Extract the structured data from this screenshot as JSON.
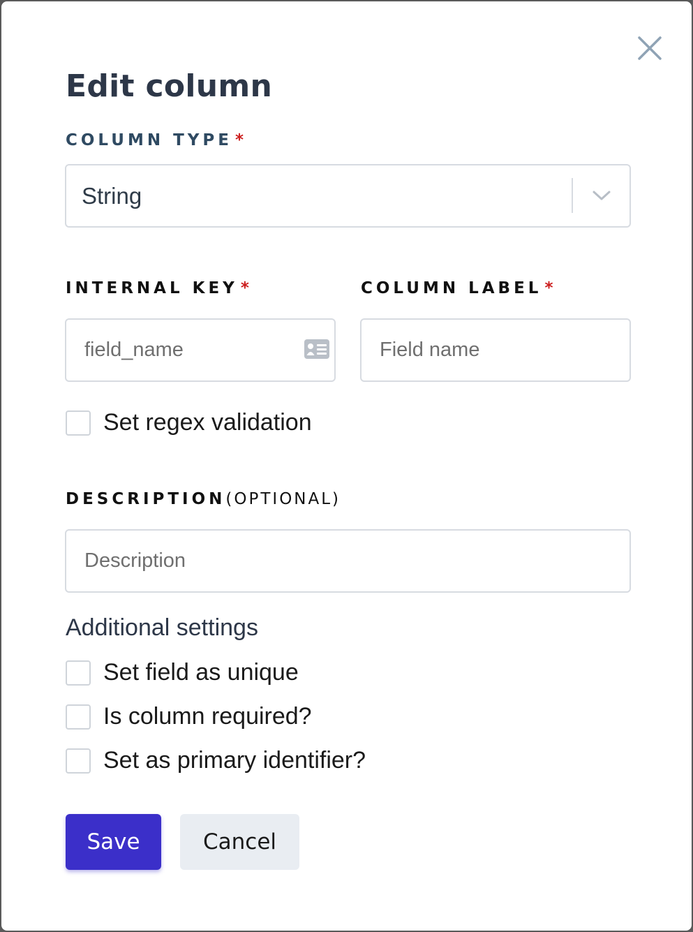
{
  "dialog": {
    "title": "Edit column",
    "close_icon": "close-icon"
  },
  "column_type": {
    "label": "COLUMN TYPE",
    "required_mark": "*",
    "selected_value": "String",
    "chevron_icon": "chevron-down-icon"
  },
  "internal_key": {
    "label": "INTERNAL KEY",
    "required_mark": "*",
    "placeholder": "field_name",
    "value": "",
    "icon": "id-card-icon"
  },
  "column_label": {
    "label": "COLUMN LABEL",
    "required_mark": "*",
    "placeholder": "Field name",
    "value": ""
  },
  "regex_validation": {
    "label": "Set regex validation",
    "checked": false
  },
  "description": {
    "label": "DESCRIPTION",
    "optional_text": "(OPTIONAL)",
    "placeholder": "Description",
    "value": ""
  },
  "additional_settings": {
    "heading": "Additional settings",
    "options": [
      {
        "label": "Set field as unique",
        "checked": false
      },
      {
        "label": "Is column required?",
        "checked": false
      },
      {
        "label": "Set as primary identifier?",
        "checked": false
      }
    ]
  },
  "actions": {
    "save_label": "Save",
    "cancel_label": "Cancel"
  },
  "colors": {
    "primary": "#3b2fc9",
    "required": "#cc1f1f",
    "label_blue": "#2f4a62",
    "cancel_bg": "#e9edf2"
  }
}
